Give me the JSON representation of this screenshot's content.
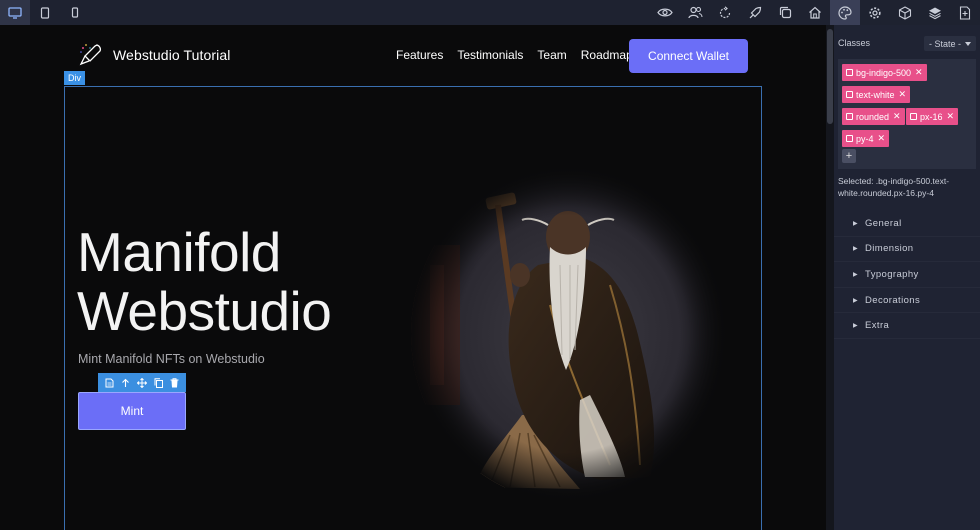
{
  "toolbar": {
    "devices": [
      {
        "name": "desktop-icon",
        "active": true
      },
      {
        "name": "tablet-icon",
        "active": false
      },
      {
        "name": "mobile-icon",
        "active": false
      }
    ],
    "tools": [
      "eye-icon",
      "users-icon",
      "sync-icon",
      "rocket-icon",
      "copy-icon",
      "home-icon",
      "palette-icon",
      "gear-icon",
      "cube-icon",
      "layers-icon",
      "add-page-icon"
    ]
  },
  "site": {
    "brand": "Webstudio Tutorial",
    "nav_links": [
      "Features",
      "Testimonials",
      "Team",
      "Roadmap"
    ],
    "connect_label": "Connect Wallet",
    "selection_tag": "Div",
    "hero_title_line1": "Manifold",
    "hero_title_line2": "Webstudio",
    "hero_subtitle": "Mint  Manifold NFTs on Webstudio",
    "mint_label": "Mint",
    "accent": "#6b6ef7"
  },
  "panel": {
    "classes_label": "Classes",
    "state_label": "- State -",
    "chips": [
      "bg-indigo-500",
      "text-white",
      "rounded",
      "px-16",
      "py-4"
    ],
    "add_label": "+",
    "selected_text": "Selected: .bg-indigo-500.text-white.rounded.px-16.py-4",
    "sections": [
      "General",
      "Dimension",
      "Typography",
      "Decorations",
      "Extra"
    ],
    "chip_color": "#e8508a"
  }
}
